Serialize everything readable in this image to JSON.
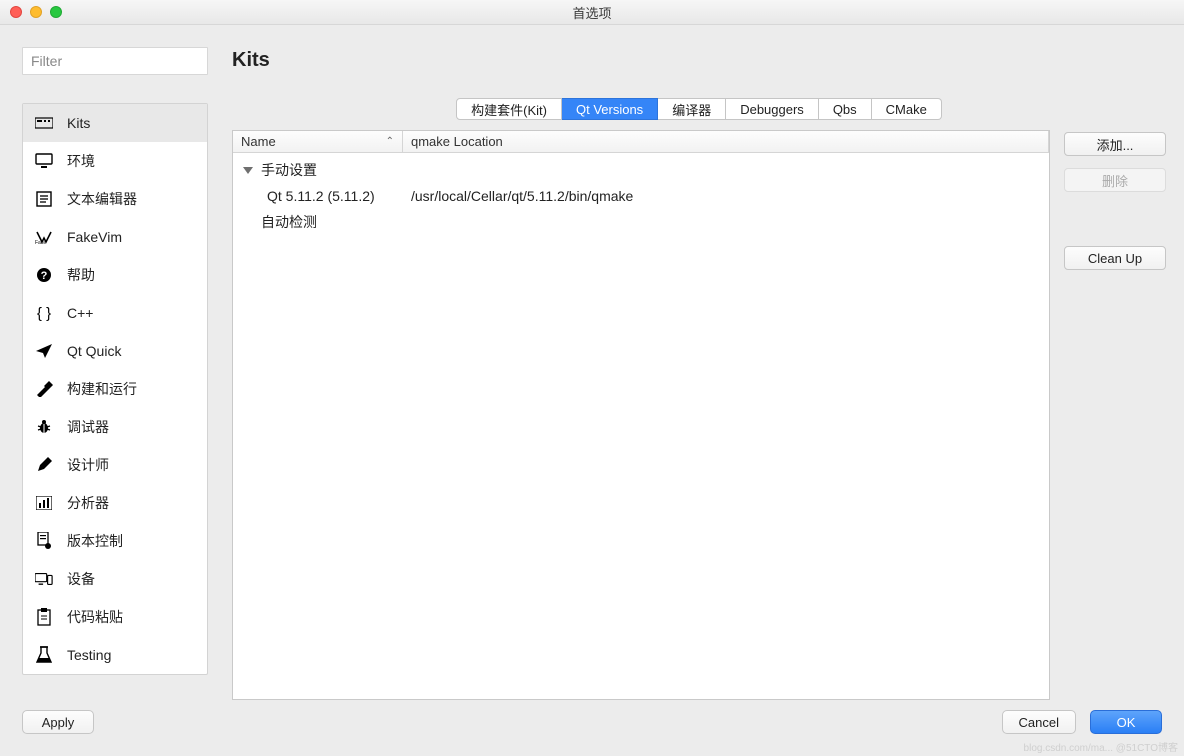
{
  "window": {
    "title": "首选项"
  },
  "sidebar": {
    "filter_placeholder": "Filter",
    "items": [
      {
        "label": "Kits"
      },
      {
        "label": "环境"
      },
      {
        "label": "文本编辑器"
      },
      {
        "label": "FakeVim"
      },
      {
        "label": "帮助"
      },
      {
        "label": "C++"
      },
      {
        "label": "Qt Quick"
      },
      {
        "label": "构建和运行"
      },
      {
        "label": "调试器"
      },
      {
        "label": "设计师"
      },
      {
        "label": "分析器"
      },
      {
        "label": "版本控制"
      },
      {
        "label": "设备"
      },
      {
        "label": "代码粘贴"
      },
      {
        "label": "Testing"
      }
    ]
  },
  "main": {
    "heading": "Kits",
    "tabs": [
      {
        "label": "构建套件(Kit)"
      },
      {
        "label": "Qt Versions"
      },
      {
        "label": "编译器"
      },
      {
        "label": "Debuggers"
      },
      {
        "label": "Qbs"
      },
      {
        "label": "CMake"
      }
    ],
    "table": {
      "columns": {
        "name": "Name",
        "location": "qmake Location"
      },
      "groups": [
        {
          "label": "手动设置",
          "expanded": true,
          "rows": [
            {
              "name": "Qt 5.11.2 (5.11.2)",
              "location": "/usr/local/Cellar/qt/5.11.2/bin/qmake"
            }
          ]
        },
        {
          "label": "自动检测",
          "expanded": false,
          "rows": []
        }
      ]
    },
    "buttons": {
      "add": "添加...",
      "remove": "删除",
      "cleanup": "Clean Up"
    }
  },
  "footer": {
    "apply": "Apply",
    "cancel": "Cancel",
    "ok": "OK"
  }
}
